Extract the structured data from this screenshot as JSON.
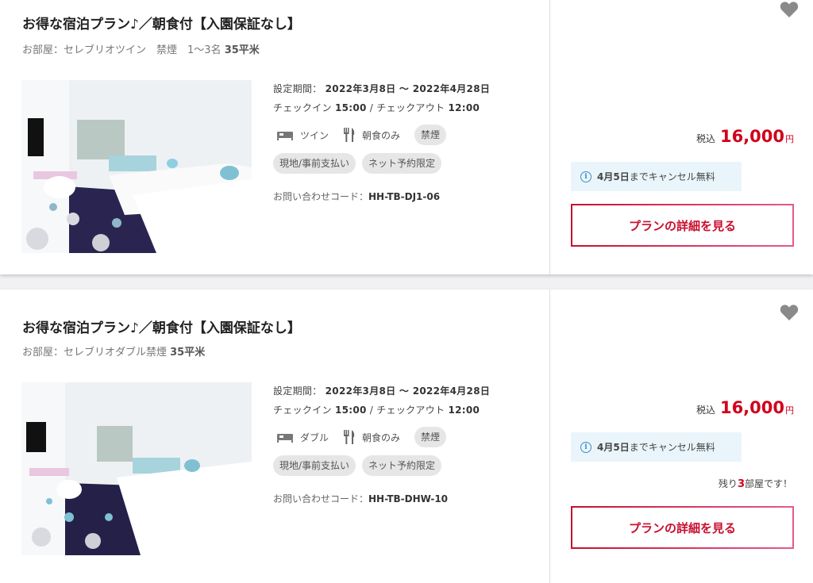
{
  "plans": [
    {
      "title": "お得な宿泊プラン♪／朝食付【入園保証なし】",
      "room_prefix": "お部屋：セレブリオツイン　禁煙　1〜3名 ",
      "room_size": "35平米",
      "period_label": "設定期間：",
      "period_value": "2022年3月8日 〜 2022年4月28日",
      "checkin_label": "チェックイン",
      "checkin_value": "15:00",
      "checkout_label": "/ チェックアウト",
      "checkout_value": "12:00",
      "bed_type": "ツイン",
      "meal": "朝食のみ",
      "tags": [
        "禁煙",
        "現地/事前支払い",
        "ネット予約限定"
      ],
      "contact_label": "お問い合わせコード：",
      "contact_code": "HH-TB-DJ1-06",
      "tax_label": "税込",
      "price": "16,000",
      "currency": "円",
      "cancel_date": "4月5日",
      "cancel_text": "までキャンセル無料",
      "remaining": null,
      "button_label": "プランの詳細を見る"
    },
    {
      "title": "お得な宿泊プラン♪／朝食付【入園保証なし】",
      "room_prefix": "お部屋：セレブリオダブル禁煙 ",
      "room_size": "35平米",
      "period_label": "設定期間：",
      "period_value": "2022年3月8日 〜 2022年4月28日",
      "checkin_label": "チェックイン",
      "checkin_value": "15:00",
      "checkout_label": "/ チェックアウト",
      "checkout_value": "12:00",
      "bed_type": "ダブル",
      "meal": "朝食のみ",
      "tags": [
        "禁煙",
        "現地/事前支払い",
        "ネット予約限定"
      ],
      "contact_label": "お問い合わせコード：",
      "contact_code": "HH-TB-DHW-10",
      "tax_label": "税込",
      "price": "16,000",
      "currency": "円",
      "cancel_date": "4月5日",
      "cancel_text": "までキャンセル無料",
      "remaining": {
        "prefix": "残り",
        "count": "3",
        "suffix": "部屋です！"
      },
      "button_label": "プランの詳細を見る"
    }
  ],
  "icons": {
    "favorite": "heart-icon",
    "bed": "bed-icon",
    "meal": "fork-knife-icon",
    "info": "info-icon"
  },
  "colors": {
    "price": "#d0021b",
    "button_border_start": "#c8102e",
    "button_border_end": "#e35a8f",
    "cancel_bg": "#eaf5fb",
    "tag_bg": "#e6e6e6"
  }
}
